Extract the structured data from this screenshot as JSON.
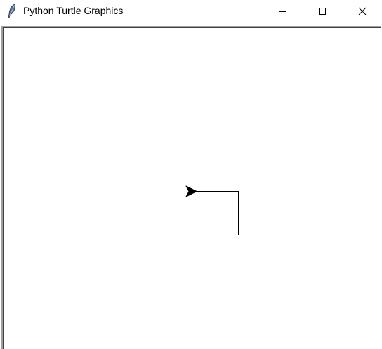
{
  "window": {
    "title": "Python Turtle Graphics",
    "icon": "feather-icon",
    "controls": [
      "minimize-icon",
      "maximize-icon",
      "close-icon"
    ]
  },
  "canvas": {
    "background": "#ffffff",
    "drawing": {
      "shape": "square",
      "stroke_color": "#000000"
    },
    "turtle": {
      "shape": "arrow",
      "color": "#000000",
      "heading": "east"
    }
  }
}
